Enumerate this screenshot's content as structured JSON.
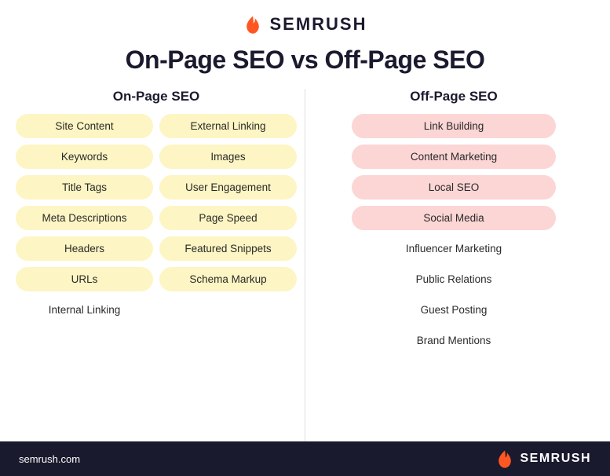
{
  "logo": {
    "text": "SEMRUSH",
    "icon_color": "#ff5722"
  },
  "main_title": "On-Page SEO vs Off-Page SEO",
  "onpage": {
    "header": "On-Page SEO",
    "col1": [
      "Site Content",
      "Keywords",
      "Title Tags",
      "Meta Descriptions",
      "Headers",
      "URLs",
      "Internal Linking"
    ],
    "col2": [
      "External Linking",
      "Images",
      "User Engagement",
      "Page Speed",
      "Featured Snippets",
      "Schema Markup"
    ]
  },
  "offpage": {
    "header": "Off-Page SEO",
    "items": [
      "Link Building",
      "Content Marketing",
      "Local SEO",
      "Social Media",
      "Influencer Marketing",
      "Public Relations",
      "Guest Posting",
      "Brand Mentions"
    ],
    "pink_count": 4
  },
  "footer": {
    "url": "semrush.com",
    "logo_text": "SEMRUSH"
  }
}
